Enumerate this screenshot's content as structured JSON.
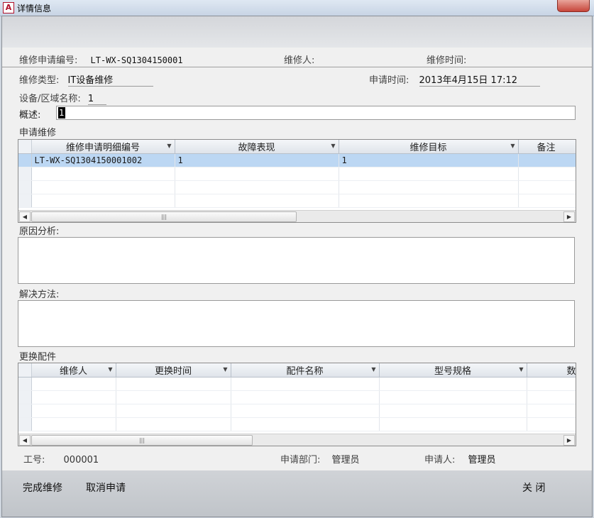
{
  "window": {
    "title": "详情信息",
    "app_icon_letter": "A"
  },
  "header": {
    "request_no_label": "维修申请编号:",
    "request_no_value": "LT-WX-SQ1304150001",
    "repairer_label": "维修人:",
    "repairer_value": "",
    "repair_time_label": "维修时间:",
    "repair_time_value": ""
  },
  "form": {
    "repair_type_label": "维修类型:",
    "repair_type_value": "IT设备维修",
    "apply_time_label": "申请时间:",
    "apply_time_value": "2013年4月15日  17:12",
    "device_label": "设备/区域名称:",
    "device_value": "1",
    "summary_label": "概述:",
    "summary_value": "1"
  },
  "repair_grid": {
    "section_title": "申请维修",
    "columns": [
      "维修申请明细编号",
      "故障表现",
      "维修目标",
      "备注"
    ],
    "rows": [
      [
        "LT-WX-SQ1304150001002",
        "1",
        "1",
        ""
      ]
    ]
  },
  "cause": {
    "label": "原因分析:"
  },
  "solution": {
    "label": "解决方法:"
  },
  "parts_grid": {
    "section_title": "更换配件",
    "columns": [
      "维修人",
      "更换时间",
      "配件名称",
      "型号规格",
      "数量"
    ],
    "rows": []
  },
  "footer_info": {
    "emp_no_label": "工号:",
    "emp_no_value": "000001",
    "dept_label": "申请部门:",
    "dept_value": "管理员",
    "applicant_label": "申请人:",
    "applicant_value": "管理员"
  },
  "actions": {
    "complete": "完成维修",
    "cancel": "取消申请",
    "close": "关 闭"
  },
  "colors": {
    "selected_row": "#bcd7f3",
    "close_button": "#c7453a"
  }
}
